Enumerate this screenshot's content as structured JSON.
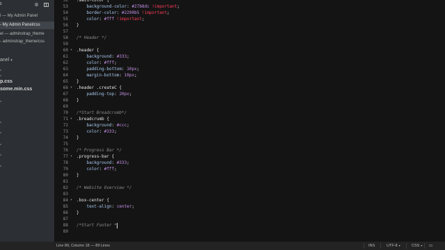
{
  "sidebar": {
    "title": "s",
    "files": [
      {
        "label": "l — My Admin Panel"
      },
      {
        "label": "- My Admin Panel/css"
      },
      {
        "label": "el — adminstrap_theme"
      },
      {
        "label": "- adminstrap_theme/css"
      }
    ],
    "folder_label": "anel",
    "css_files": [
      {
        "label": "p.css"
      },
      {
        "label": "some.min.css"
      }
    ]
  },
  "editor": {
    "lines": [
      {
        "n": "52",
        "parts": [
          {
            "t": ".main-color {",
            "c": "t-sel"
          }
        ]
      },
      {
        "n": "53",
        "parts": [
          {
            "t": "    "
          },
          {
            "t": "background-color",
            "c": "t-prop"
          },
          {
            "t": ": "
          },
          {
            "t": "#27b8dc",
            "c": "t-num"
          },
          {
            "t": " "
          },
          {
            "t": "!important",
            "c": "t-imp"
          },
          {
            "t": ";"
          }
        ]
      },
      {
        "n": "54",
        "parts": [
          {
            "t": "    "
          },
          {
            "t": "border-color",
            "c": "t-prop"
          },
          {
            "t": ": "
          },
          {
            "t": "#2290b5",
            "c": "t-num"
          },
          {
            "t": " "
          },
          {
            "t": "!important",
            "c": "t-imp"
          },
          {
            "t": ";"
          }
        ]
      },
      {
        "n": "55",
        "parts": [
          {
            "t": "    "
          },
          {
            "t": "color",
            "c": "t-prop"
          },
          {
            "t": ": "
          },
          {
            "t": "#fff",
            "c": "t-num"
          },
          {
            "t": " "
          },
          {
            "t": "!important",
            "c": "t-imp"
          },
          {
            "t": ";"
          }
        ]
      },
      {
        "n": "56",
        "parts": [
          {
            "t": "}"
          }
        ]
      },
      {
        "n": "57",
        "parts": []
      },
      {
        "n": "58",
        "parts": [
          {
            "t": "/* Header */",
            "c": "t-com"
          }
        ]
      },
      {
        "n": "59",
        "parts": []
      },
      {
        "n": "60",
        "parts": [
          {
            "t": ".header {",
            "c": "t-sel"
          }
        ],
        "fold": true
      },
      {
        "n": "61",
        "parts": [
          {
            "t": "    "
          },
          {
            "t": "background",
            "c": "t-prop"
          },
          {
            "t": ": "
          },
          {
            "t": "#333",
            "c": "t-num"
          },
          {
            "t": ";"
          }
        ]
      },
      {
        "n": "62",
        "parts": [
          {
            "t": "    "
          },
          {
            "t": "color",
            "c": "t-prop"
          },
          {
            "t": ": "
          },
          {
            "t": "#fff",
            "c": "t-num"
          },
          {
            "t": ";"
          }
        ]
      },
      {
        "n": "63",
        "parts": [
          {
            "t": "    "
          },
          {
            "t": "padding-bottom",
            "c": "t-prop"
          },
          {
            "t": ": "
          },
          {
            "t": "10px",
            "c": "t-num"
          },
          {
            "t": ";"
          }
        ]
      },
      {
        "n": "64",
        "parts": [
          {
            "t": "    "
          },
          {
            "t": "margin-bottom",
            "c": "t-prop"
          },
          {
            "t": ": "
          },
          {
            "t": "10px",
            "c": "t-num"
          },
          {
            "t": ";"
          }
        ]
      },
      {
        "n": "65",
        "parts": [
          {
            "t": "}"
          }
        ]
      },
      {
        "n": "66",
        "parts": [
          {
            "t": ".header .createC {",
            "c": "t-sel"
          }
        ],
        "fold": true
      },
      {
        "n": "67",
        "parts": [
          {
            "t": "    "
          },
          {
            "t": "padding-top",
            "c": "t-prop"
          },
          {
            "t": ": "
          },
          {
            "t": "20px",
            "c": "t-num"
          },
          {
            "t": ";"
          }
        ]
      },
      {
        "n": "68",
        "parts": [
          {
            "t": "}"
          }
        ]
      },
      {
        "n": "69",
        "parts": []
      },
      {
        "n": "70",
        "parts": [
          {
            "t": "/*Start Breadcrumb*/",
            "c": "t-com"
          }
        ]
      },
      {
        "n": "71",
        "parts": [
          {
            "t": ".breadcrumb {",
            "c": "t-sel"
          }
        ],
        "fold": true
      },
      {
        "n": "72",
        "parts": [
          {
            "t": "    "
          },
          {
            "t": "background",
            "c": "t-prop"
          },
          {
            "t": ": "
          },
          {
            "t": "#ccc",
            "c": "t-num"
          },
          {
            "t": ";"
          }
        ]
      },
      {
        "n": "73",
        "parts": [
          {
            "t": "    "
          },
          {
            "t": "color",
            "c": "t-prop"
          },
          {
            "t": ": "
          },
          {
            "t": "#333",
            "c": "t-num"
          },
          {
            "t": ";"
          }
        ]
      },
      {
        "n": "74",
        "parts": [
          {
            "t": "}"
          }
        ]
      },
      {
        "n": "75",
        "parts": []
      },
      {
        "n": "76",
        "parts": [
          {
            "t": "/* Progress Bar */",
            "c": "t-com"
          }
        ]
      },
      {
        "n": "77",
        "parts": [
          {
            "t": ".progress-bar {",
            "c": "t-sel"
          }
        ],
        "fold": true
      },
      {
        "n": "78",
        "parts": [
          {
            "t": "    "
          },
          {
            "t": "background",
            "c": "t-prop"
          },
          {
            "t": ": "
          },
          {
            "t": "#333",
            "c": "t-num"
          },
          {
            "t": ";"
          }
        ]
      },
      {
        "n": "79",
        "parts": [
          {
            "t": "    "
          },
          {
            "t": "color",
            "c": "t-prop"
          },
          {
            "t": ": "
          },
          {
            "t": "#fff",
            "c": "t-num"
          },
          {
            "t": ";"
          }
        ]
      },
      {
        "n": "80",
        "parts": [
          {
            "t": "}"
          }
        ]
      },
      {
        "n": "81",
        "parts": []
      },
      {
        "n": "82",
        "parts": [
          {
            "t": "/* Website Overview */",
            "c": "t-com"
          }
        ]
      },
      {
        "n": "83",
        "parts": []
      },
      {
        "n": "84",
        "parts": [
          {
            "t": ".box-center {",
            "c": "t-sel"
          }
        ],
        "fold": true
      },
      {
        "n": "85",
        "parts": [
          {
            "t": "    "
          },
          {
            "t": "text-align",
            "c": "t-prop"
          },
          {
            "t": ": "
          },
          {
            "t": "center",
            "c": "t-num"
          },
          {
            "t": ";"
          }
        ]
      },
      {
        "n": "86",
        "parts": [
          {
            "t": "}"
          }
        ]
      },
      {
        "n": "87",
        "parts": []
      },
      {
        "n": "88",
        "parts": [
          {
            "t": "/*Start Footer *",
            "c": "t-com"
          }
        ],
        "cursor": true
      },
      {
        "n": "89",
        "parts": []
      }
    ]
  },
  "statusbar": {
    "position": "Line 89, Column 18 — 89 Lines",
    "mode": "INS",
    "encoding": "UTF-8",
    "syntax": "CSS"
  }
}
